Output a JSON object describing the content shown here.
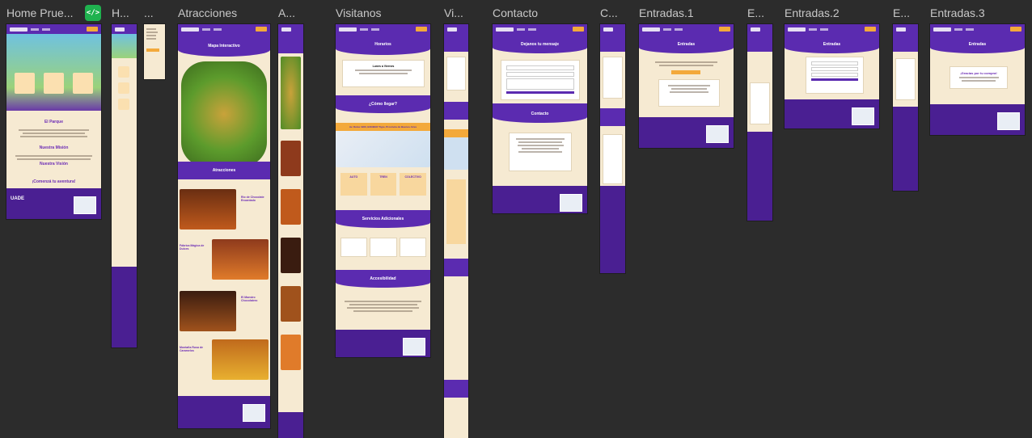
{
  "canvas": {
    "frames": [
      {
        "id": "home",
        "label": "Home Prue..."
      },
      {
        "id": "home-mobile",
        "label": "H..."
      },
      {
        "id": "menu-mobile",
        "label": "..."
      },
      {
        "id": "atracciones",
        "label": "Atracciones"
      },
      {
        "id": "atracciones-mobile",
        "label": "A..."
      },
      {
        "id": "visitanos",
        "label": "Visitanos"
      },
      {
        "id": "visitanos-mobile",
        "label": "Vi..."
      },
      {
        "id": "contacto",
        "label": "Contacto"
      },
      {
        "id": "contacto-mobile",
        "label": "C..."
      },
      {
        "id": "entradas-1",
        "label": "Entradas.1"
      },
      {
        "id": "entradas-1-mobile",
        "label": "E..."
      },
      {
        "id": "entradas-2",
        "label": "Entradas.2"
      },
      {
        "id": "entradas-2-mobile",
        "label": "E..."
      },
      {
        "id": "entradas-3",
        "label": "Entradas.3"
      }
    ],
    "code_badge": "</>"
  },
  "content": {
    "brand": "WONKA'S PARK",
    "nav": [
      "Home",
      "Atracciones",
      "Visitanos",
      "Contacto"
    ],
    "home": {
      "parque": "El Parque",
      "mision": "Nuestra Misión",
      "vision": "Nuestra Visión",
      "aventura": "¡Comenzá tu aventura!",
      "cta": "Ver Más"
    },
    "atracciones": {
      "mapa": "Mapa Interactivo",
      "seccion": "Atracciones",
      "items": [
        "Río de Chocolate Encantado",
        "Fábrica Mágica de Dulces",
        "El Maestro Chocolatero",
        "Montaña Rusa de Caramelos"
      ]
    },
    "visitanos": {
      "horarios": "Horarios",
      "dias": "Lunes a Viernes",
      "como": "¿Cómo llegar?",
      "direccion": "Av. Dulce 1900, B1648AR Tigre, Provincia de Buenos Aires",
      "transporte": [
        "AUTO",
        "TREN",
        "COLECTIVO"
      ],
      "servicios": "Servicios Adicionales",
      "accesibilidad": "Accesibilidad"
    },
    "contacto": {
      "mensaje": "Dejanos tu mensaje",
      "titulo": "Contacto"
    },
    "entradas": {
      "titulo": "Entradas",
      "gracias": "¡Gracias por tu compra!"
    },
    "footer": {
      "logo": "UADE"
    }
  }
}
